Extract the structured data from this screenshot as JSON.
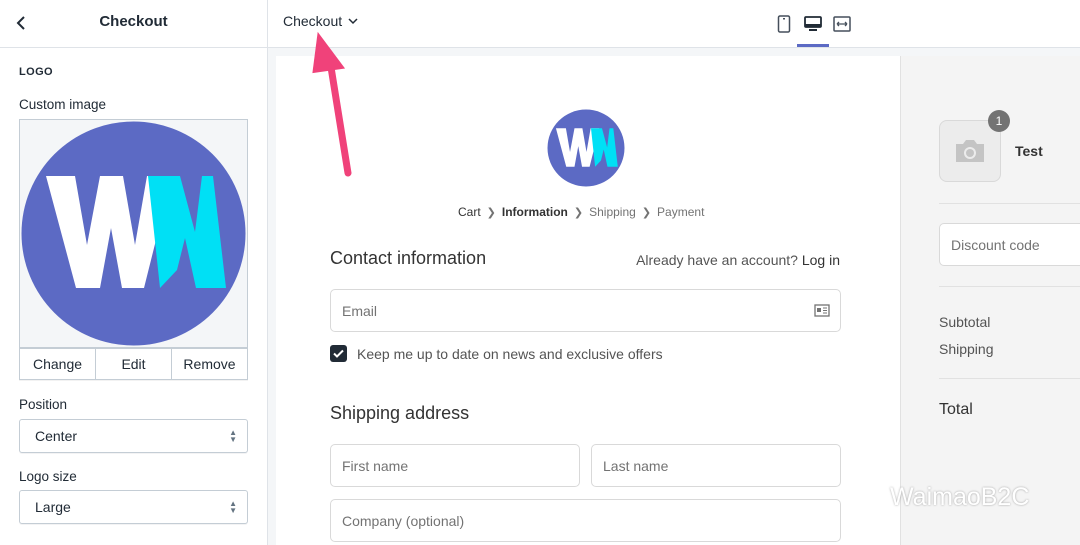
{
  "sidebar": {
    "title": "Checkout",
    "section_heading": "LOGO",
    "custom_image_label": "Custom image",
    "image_buttons": {
      "change": "Change",
      "edit": "Edit",
      "remove": "Remove"
    },
    "position_label": "Position",
    "position_value": "Center",
    "logo_size_label": "Logo size",
    "logo_size_value": "Large"
  },
  "topbar": {
    "page_select": "Checkout",
    "devices": [
      "mobile-icon",
      "desktop-icon",
      "full-width-icon"
    ],
    "active_device": "desktop"
  },
  "logo": {
    "letters": "WM",
    "circle_color": "#5c6ac4",
    "w_color": "#ffffff",
    "m_color": "#00e0f5"
  },
  "preview": {
    "breadcrumb": [
      "Cart",
      "Information",
      "Shipping",
      "Payment"
    ],
    "contact_heading": "Contact information",
    "account_prompt": "Already have an account?",
    "login_link": "Log in",
    "email_placeholder": "Email",
    "newsletter_label": "Keep me up to date on news and exclusive offers",
    "newsletter_checked": true,
    "shipping_heading": "Shipping address",
    "first_name_placeholder": "First name",
    "last_name_placeholder": "Last name",
    "company_placeholder": "Company (optional)"
  },
  "summary": {
    "quantity": "1",
    "product_name": "Test",
    "discount_placeholder": "Discount code",
    "subtotal_label": "Subtotal",
    "shipping_label": "Shipping",
    "total_label": "Total"
  },
  "annotation": {
    "arrow_color": "#f0427a"
  },
  "watermark": {
    "text": "WaimaoB2C"
  }
}
